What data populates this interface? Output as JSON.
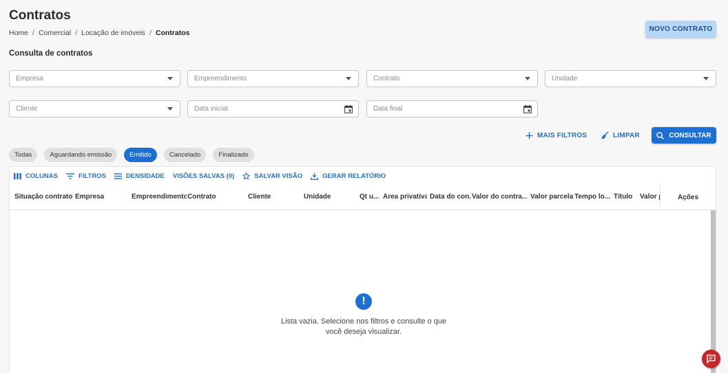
{
  "header": {
    "title": "Contratos",
    "breadcrumb": [
      "Home",
      "Comercial",
      "Locação de imóveis",
      "Contratos"
    ],
    "new_button": "NOVO CONTRATO"
  },
  "search": {
    "title": "Consulta de contratos",
    "fields": {
      "empresa": "Empresa",
      "empreendimento": "Empreendimento",
      "contrato": "Contrato",
      "unidade": "Unidade",
      "cliente": "Cliente",
      "data_inicial": "Data inicial",
      "data_final": "Data final"
    },
    "more_filters": "MAIS FILTROS",
    "clear": "LIMPAR",
    "consult": "CONSULTAR"
  },
  "status_chips": [
    {
      "label": "Todas",
      "active": false
    },
    {
      "label": "Aguardando emissão",
      "active": false
    },
    {
      "label": "Emitido",
      "active": true
    },
    {
      "label": "Cancelado",
      "active": false
    },
    {
      "label": "Finalizado",
      "active": false
    }
  ],
  "grid": {
    "toolbar": [
      "COLUNAS",
      "FILTROS",
      "DENSIDADE",
      "VISÕES SALVAS (0)",
      "SALVAR VISÃO",
      "GERAR RELATÓRIO"
    ],
    "columns": [
      "Situação contrato",
      "Empresa",
      "Empreendimento",
      "Contrato",
      "Cliente",
      "Unidade",
      "Qt u...",
      "Área privativa",
      "Data do con...",
      "Valor do contra...",
      "Valor parcela",
      "Tempo lo...",
      "Título",
      "Valor p"
    ],
    "actions_column": "Ações",
    "empty_icon": "!",
    "empty_line1": "Lista vazia. Selecione nos filtros e consulte o que",
    "empty_line2": "você deseja visualizar."
  },
  "colors": {
    "primary": "#1e6fd0",
    "primary_light": "#b7d7f7",
    "chat": "#c0282b"
  }
}
